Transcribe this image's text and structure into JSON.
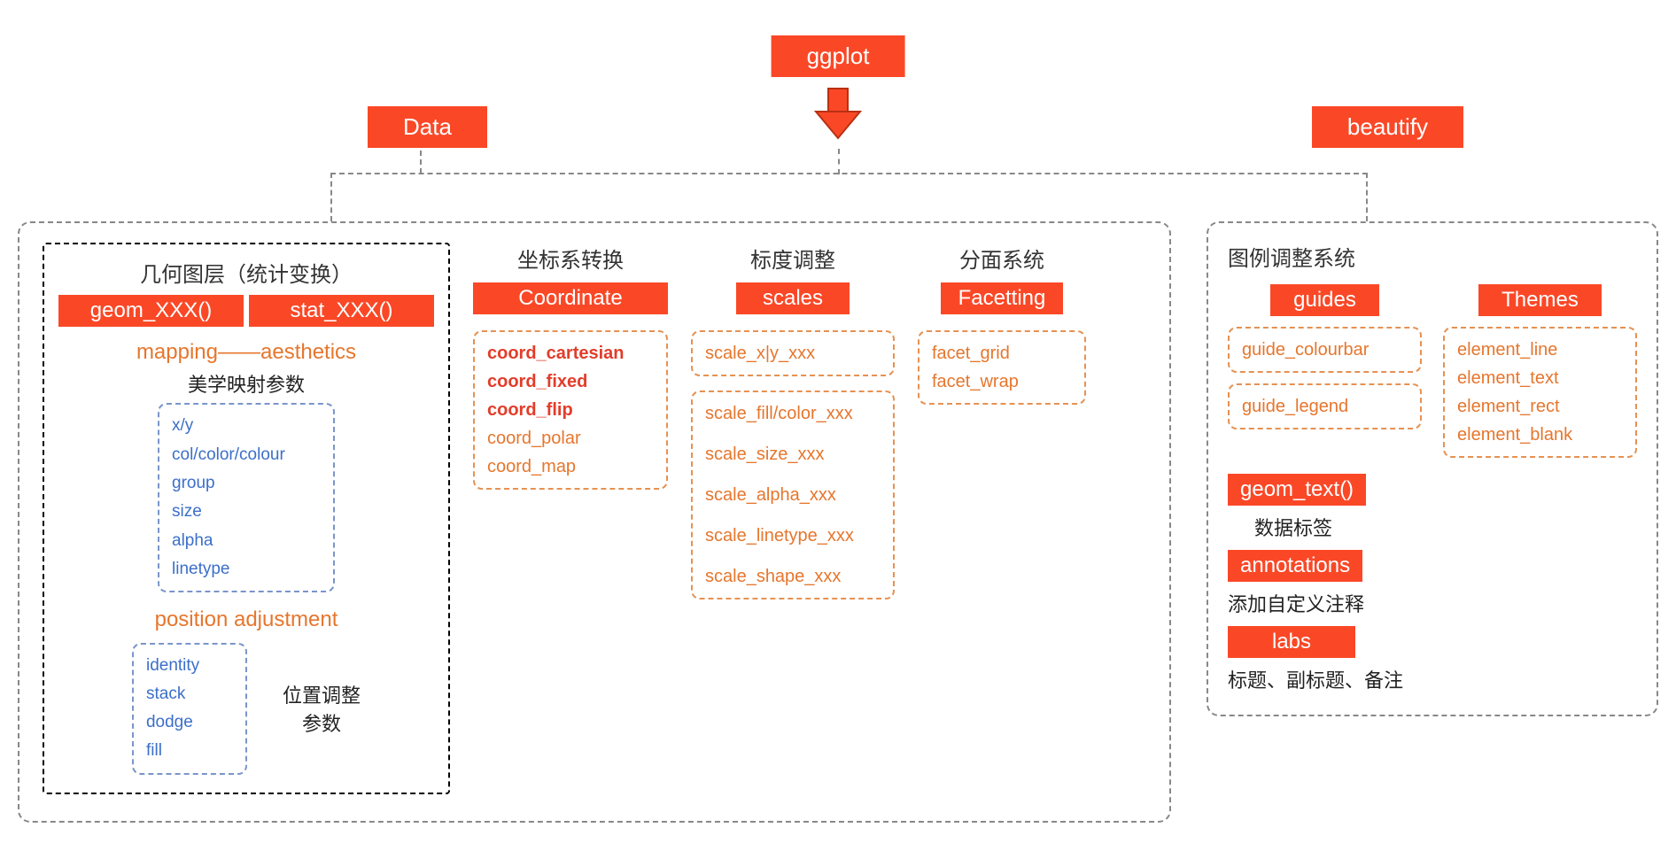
{
  "top": {
    "ggplot": "ggplot",
    "data": "Data",
    "beautify": "beautify"
  },
  "geom": {
    "header": "几何图层（统计变换）",
    "geom_btn": "geom_XXX()",
    "stat_btn": "stat_XXX()",
    "mapping_title": "mapping——aesthetics",
    "mapping_sub": "美学映射参数",
    "aes": [
      "x/y",
      "col/color/colour",
      "group",
      "size",
      "alpha",
      "linetype"
    ],
    "position_title": "position adjustment",
    "position_sub1": "位置调整",
    "position_sub2": "参数",
    "positions": [
      "identity",
      "stack",
      "dodge",
      "fill"
    ]
  },
  "coord": {
    "header": "坐标系转换",
    "btn": "Coordinate",
    "bold": [
      "coord_cartesian",
      "coord_fixed",
      "coord_flip"
    ],
    "reg": [
      "coord_polar",
      "coord_map"
    ]
  },
  "scales": {
    "header": "标度调整",
    "btn": "scales",
    "group1": [
      "scale_x|y_xxx"
    ],
    "group2": [
      "scale_fill/color_xxx",
      "scale_size_xxx",
      "scale_alpha_xxx",
      "scale_linetype_xxx",
      "scale_shape_xxx"
    ]
  },
  "facet": {
    "header": "分面系统",
    "btn": "Facetting",
    "items": [
      "facet_grid",
      "facet_wrap"
    ]
  },
  "beautify": {
    "header": "图例调整系统",
    "guides_btn": "guides",
    "themes_btn": "Themes",
    "guides_items1": [
      "guide_colourbar"
    ],
    "guides_items2": [
      "guide_legend"
    ],
    "themes_items": [
      "element_line",
      "element_text",
      "element_rect",
      "element_blank"
    ],
    "geom_text_btn": "geom_text()",
    "geom_text_desc": "数据标签",
    "annotations_btn": "annotations",
    "annotations_desc": "添加自定义注释",
    "labs_btn": "labs",
    "labs_desc": "标题、副标题、备注"
  }
}
